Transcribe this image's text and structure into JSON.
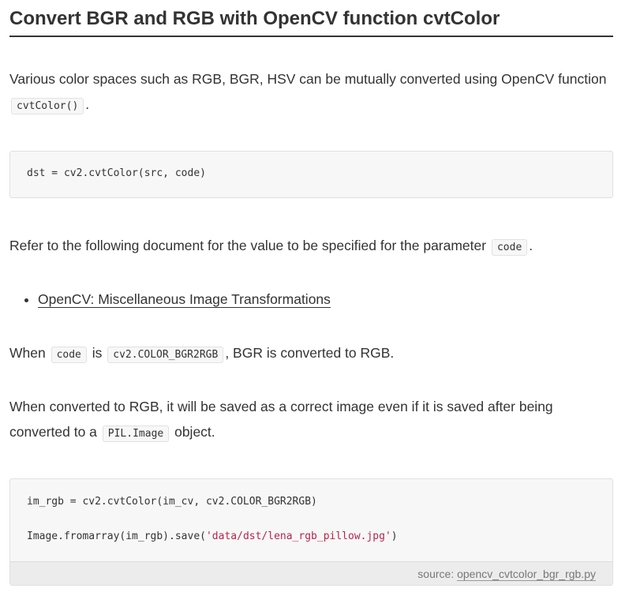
{
  "section": {
    "title": "Convert BGR and RGB with OpenCV function cvtColor"
  },
  "intro": {
    "text_before": "Various color spaces such as RGB, BGR, HSV can be mutually converted using OpenCV function ",
    "code": "cvtColor()",
    "text_after": "."
  },
  "code_block_1": {
    "line": "dst = cv2.cvtColor(src, code)"
  },
  "refer": {
    "text_before": "Refer to the following document for the value to be specified for the parameter ",
    "code": "code",
    "text_after": "."
  },
  "links": [
    {
      "label": "OpenCV: Miscellaneous Image Transformations"
    }
  ],
  "when": {
    "text_1": "When ",
    "code_1": "code",
    "text_2": " is ",
    "code_2": "cv2.COLOR_BGR2RGB",
    "text_3": ", BGR is converted to RGB."
  },
  "converted": {
    "text_before": "When converted to RGB, it will be saved as a correct image even if it is saved after being converted to a ",
    "code": "PIL.Image",
    "text_after": " object."
  },
  "code_block_2": {
    "line_1": "im_rgb = cv2.cvtColor(im_cv, cv2.COLOR_BGR2RGB)",
    "line_2_prefix": "Image.fromarray(im_rgb).save(",
    "line_2_string": "'data/dst/lena_rgb_pillow.jpg'",
    "line_2_suffix": ")",
    "source_label": "source: ",
    "source_file": "opencv_cvtcolor_bgr_rgb.py"
  },
  "colors": {
    "text": "#333333",
    "code_bg": "#f7f7f7",
    "string": "#b4264a",
    "source_bar_bg": "#ececec"
  }
}
